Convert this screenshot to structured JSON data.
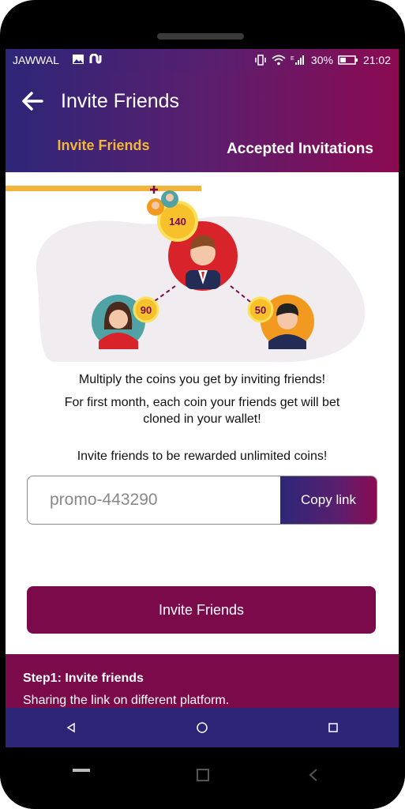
{
  "status_bar": {
    "carrier": "JAWWAL",
    "battery": "30%",
    "time": "21:02"
  },
  "app_bar": {
    "title": "Invite Friends"
  },
  "tabs": [
    {
      "label": "Invite Friends",
      "active": true
    },
    {
      "label": "Accepted Invitations",
      "active": false
    }
  ],
  "illustration": {
    "coins": [
      "140",
      "90",
      "50"
    ]
  },
  "content": {
    "line1": "Multiply the coins you get by inviting friends!",
    "line2": "For first month, each coin your friends get will bet",
    "line3": "cloned in your wallet!",
    "line4": "Invite friends to be rewarded unlimited coins!"
  },
  "promo": {
    "code": "promo-443290",
    "copy_label": "Copy link"
  },
  "invite_button": {
    "label": "Invite Friends"
  },
  "steps": {
    "title": "Step1: Invite friends",
    "desc": "Sharing the link on different platform."
  },
  "colors": {
    "accent": "#f0b53a",
    "primary": "#7b0a4b",
    "nav": "#2d2678"
  }
}
